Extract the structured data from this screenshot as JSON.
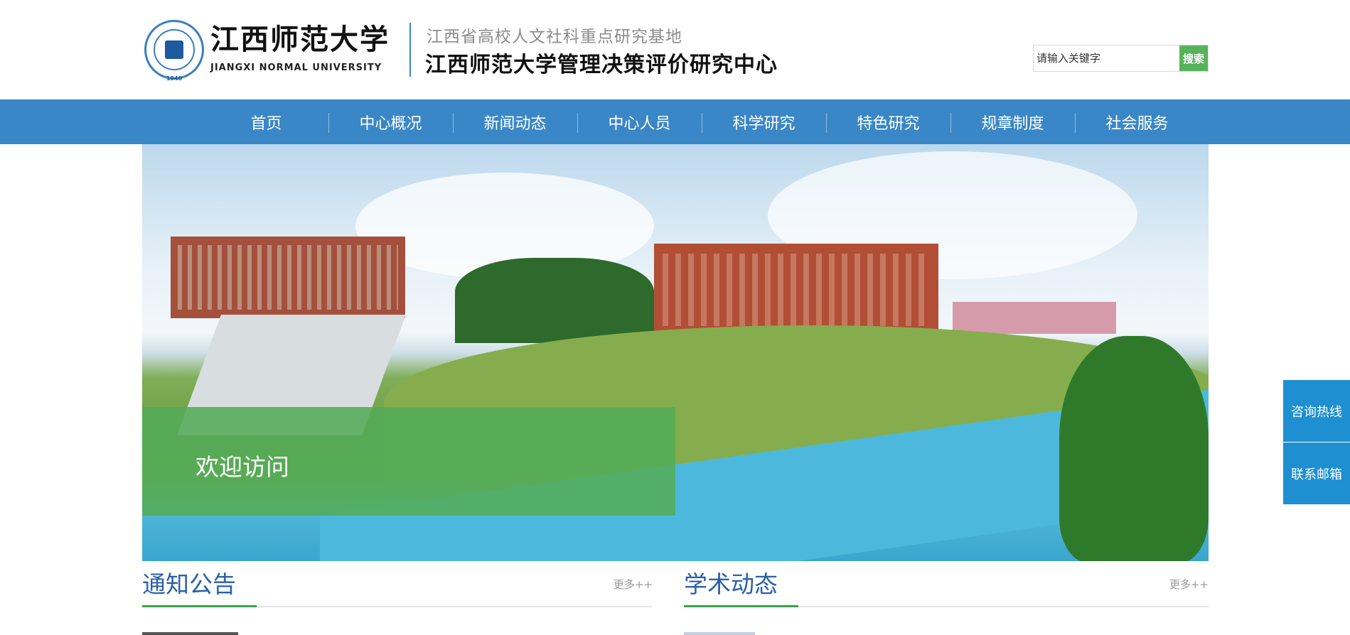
{
  "header": {
    "univ_name_cn": "江西师范大学",
    "univ_name_en": "JIANGXI NORMAL UNIVERSITY",
    "seal_year": "1940",
    "subtitle": "江西省高校人文社科重点研究基地",
    "title": "江西师范大学管理决策评价研究中心"
  },
  "search": {
    "placeholder": "请输入关键字",
    "button_label": "搜索"
  },
  "nav": {
    "items": [
      {
        "label": "首页"
      },
      {
        "label": "中心概况"
      },
      {
        "label": "新闻动态"
      },
      {
        "label": "中心人员"
      },
      {
        "label": "科学研究"
      },
      {
        "label": "特色研究"
      },
      {
        "label": "规章制度"
      },
      {
        "label": "社会服务"
      }
    ]
  },
  "banner": {
    "welcome_text": "欢迎访问"
  },
  "side_float": {
    "items": [
      {
        "label": "咨询热线"
      },
      {
        "label": "联系邮箱"
      }
    ]
  },
  "sections": {
    "notice": {
      "title": "通知公告",
      "more": "更多++"
    },
    "academic": {
      "title": "学术动态",
      "more": "更多++"
    }
  },
  "colors": {
    "nav_bg": "#3a87c7",
    "accent_green": "#57b35b",
    "side_blue": "#1e8fd0",
    "section_title": "#2a60a8"
  }
}
